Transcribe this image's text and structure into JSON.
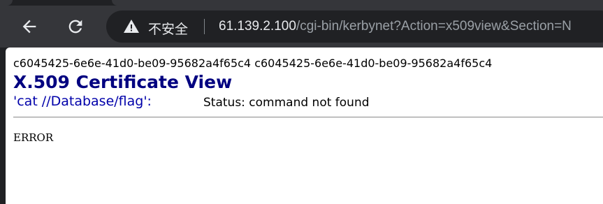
{
  "browser": {
    "security_label": "不安全",
    "url_host": "61.139.2.100",
    "url_path": "/cgi-bin/kerbynet?Action=x509view&Section=N",
    "icons": {
      "back": "back-arrow-icon",
      "reload": "reload-icon",
      "warning": "warning-triangle-icon"
    }
  },
  "page": {
    "id_line": "c6045425-6e6e-41d0-be09-95682a4f65c4 c6045425-6e6e-41d0-be09-95682a4f65c4",
    "title": "X.509 Certificate View",
    "command_label": "'cat //Database/flag':",
    "status": "Status: command not found",
    "body_text": "ERROR",
    "colors": {
      "title": "#000080",
      "command": "#0000aa"
    }
  }
}
